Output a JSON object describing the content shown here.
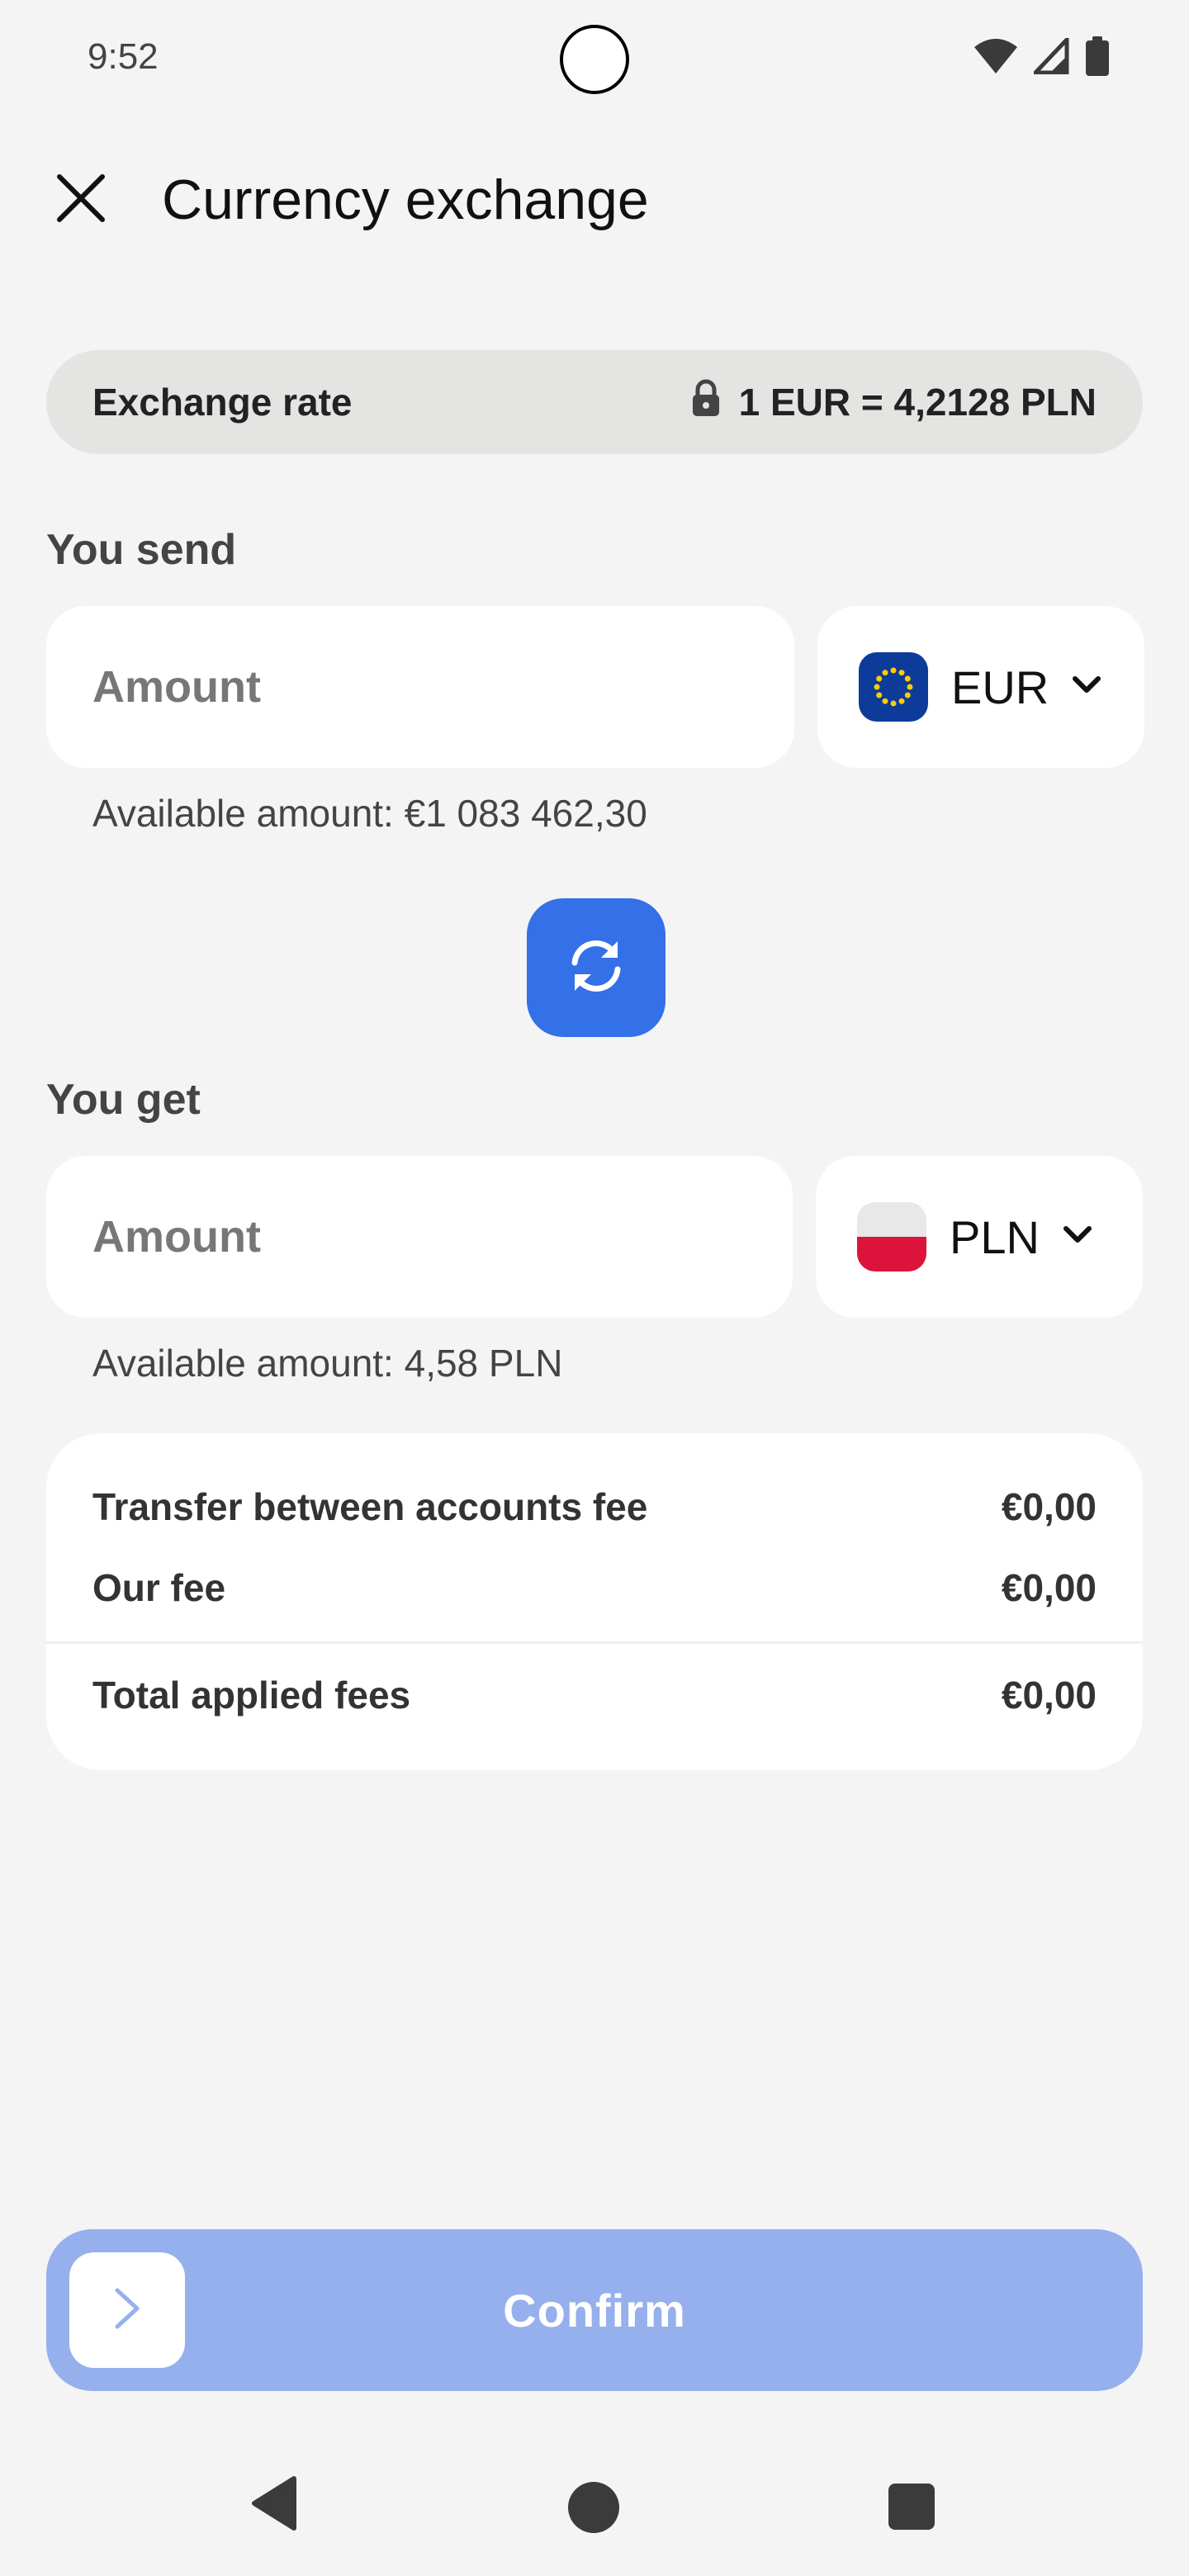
{
  "status_bar": {
    "time": "9:52",
    "icons": [
      "wifi-icon",
      "signal-icon",
      "battery-icon"
    ]
  },
  "header": {
    "title": "Currency exchange",
    "close_icon": "close-icon"
  },
  "exchange_rate": {
    "label": "Exchange rate",
    "value": "1 EUR = 4,2128 PLN",
    "icon": "lock-icon"
  },
  "send": {
    "label": "You send",
    "placeholder": "Amount",
    "currency": "EUR",
    "available": "Available amount: €1 083 462,30"
  },
  "get": {
    "label": "You get",
    "placeholder": "Amount",
    "currency": "PLN",
    "available": "Available amount: 4,58 PLN"
  },
  "fees": {
    "rows": [
      {
        "label": "Transfer between accounts fee",
        "value": "€0,00"
      },
      {
        "label": "Our fee",
        "value": "€0,00"
      }
    ],
    "total": {
      "label": "Total applied fees",
      "value": "€0,00"
    }
  },
  "confirm": {
    "label": "Confirm"
  },
  "colors": {
    "accent": "#3470e8",
    "confirm_disabled": "#96b0ed",
    "background": "#f4f4f4"
  }
}
